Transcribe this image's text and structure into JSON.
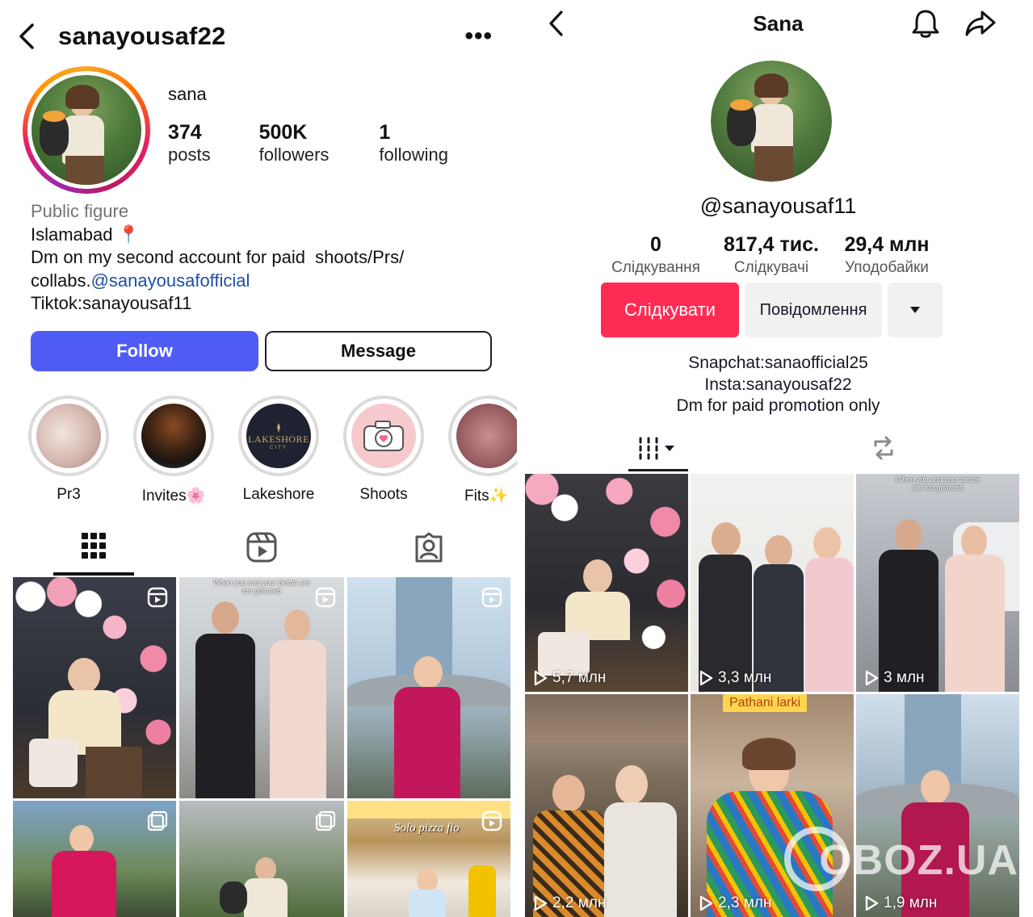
{
  "instagram": {
    "username": "sanayousaf22",
    "more": "•••",
    "display_name": "sana",
    "stats": [
      {
        "value": "374",
        "label": "posts"
      },
      {
        "value": "500K",
        "label": "followers"
      },
      {
        "value": "1",
        "label": "following"
      }
    ],
    "category": "Public figure",
    "bio_location": "Islamabad 📍",
    "bio_line2": "Dm on my second account for paid  shoots/Prs/",
    "bio_line3_prefix": "collabs.",
    "bio_link": "@sanayousafofficial",
    "bio_line4": "Tiktok:sanayousaf11",
    "follow_label": "Follow",
    "message_label": "Message",
    "highlights": [
      {
        "label": "Pr3"
      },
      {
        "label": "Invites🌸"
      },
      {
        "label": "Lakeshore",
        "logo_text": "LAKESHORE",
        "logo_sub": "CITY"
      },
      {
        "label": "Shoots"
      },
      {
        "label": "Fits✨"
      }
    ],
    "grid_captions": {
      "post2": "When you and your bestie are too ghareeb",
      "post6": "Solo pizza fio"
    }
  },
  "tiktok": {
    "title": "Sana",
    "handle": "@sanayousaf11",
    "stats": [
      {
        "value": "0",
        "label": "Слідкування"
      },
      {
        "value": "817,4 тис.",
        "label": "Слідкувачі"
      },
      {
        "value": "29,4 млн",
        "label": "Уподобайки"
      }
    ],
    "follow_label": "Слідкувати",
    "message_label": "Повідомлення",
    "bio": [
      "Snapchat:sanaofficial25",
      "Insta:sanayousaf22",
      "Dm for paid promotion only"
    ],
    "videos": [
      {
        "views": "5,7 млн"
      },
      {
        "views": "3,3 млн"
      },
      {
        "views": "3 млн",
        "caption": "When you and your bestie are too ghareeb"
      },
      {
        "views": "2,2 млн"
      },
      {
        "views": "2,3 млн",
        "sticker": "Pathani larki"
      },
      {
        "views": "1,9 млн"
      }
    ],
    "watermark": "OBOZ.UA"
  },
  "colors": {
    "ig_follow": "#4f5bf5",
    "ig_link": "#1e4fa3",
    "tt_follow": "#fe2c55",
    "tt_secondary": "#f1f1f2"
  }
}
